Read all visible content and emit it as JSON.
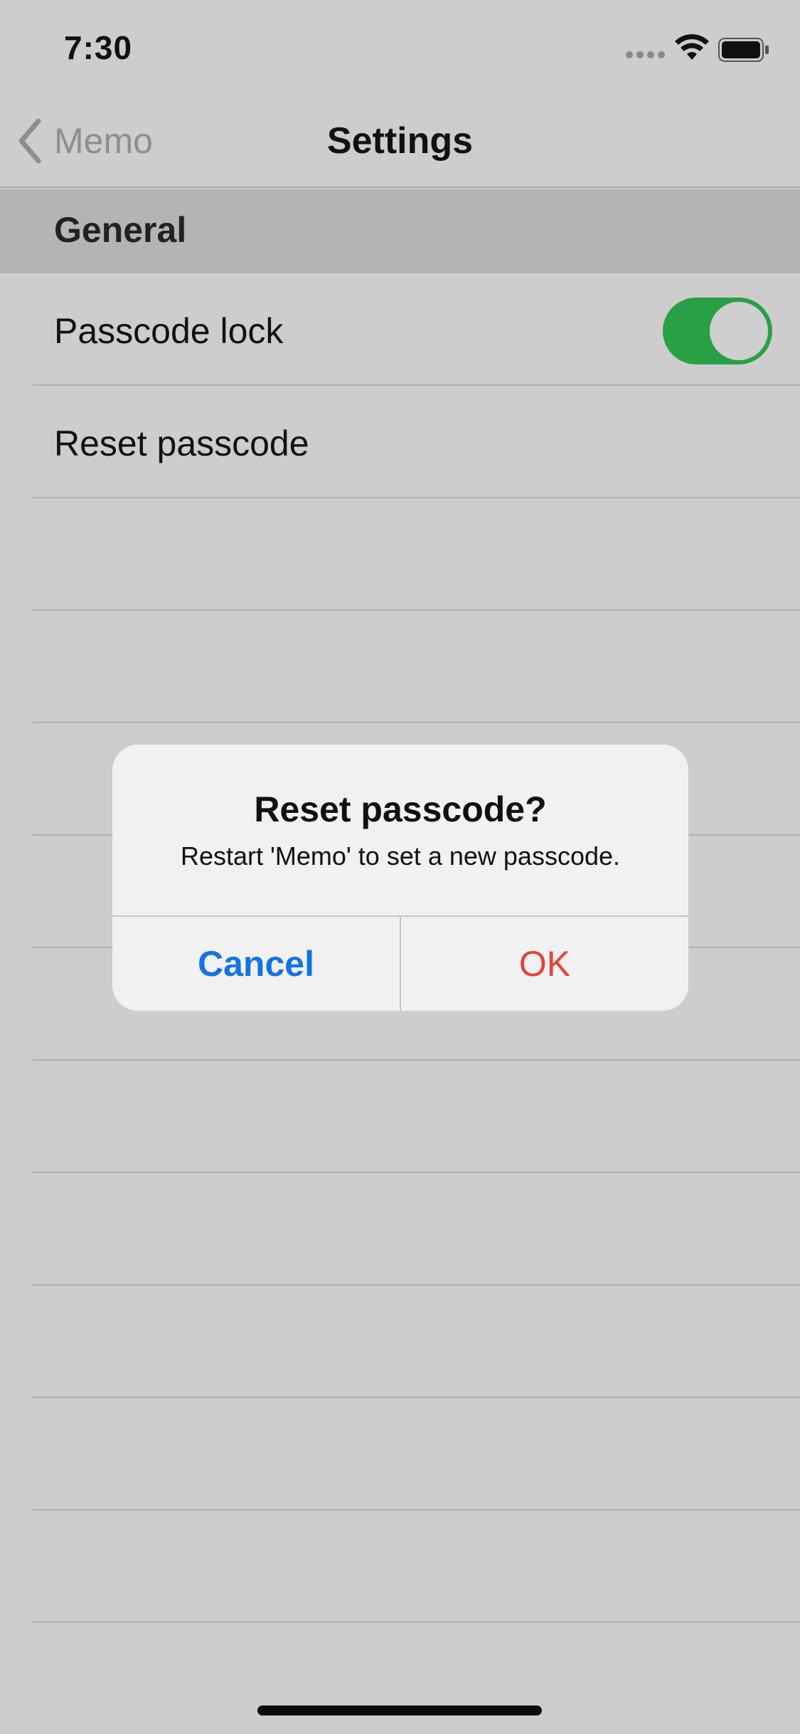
{
  "status_bar": {
    "time": "7:30",
    "icons": [
      "signal-icon",
      "wifi-icon",
      "battery-icon"
    ]
  },
  "nav": {
    "back_label": "Memo",
    "back_icon": "chevron-left-icon",
    "title": "Settings"
  },
  "section": {
    "header": "General"
  },
  "rows": [
    {
      "label": "Passcode lock",
      "has_toggle": true,
      "toggle_on": true
    },
    {
      "label": "Reset passcode"
    },
    {
      "label": ""
    },
    {
      "label": ""
    },
    {
      "label": ""
    },
    {
      "label": ""
    },
    {
      "label": ""
    },
    {
      "label": ""
    },
    {
      "label": ""
    },
    {
      "label": ""
    },
    {
      "label": ""
    },
    {
      "label": ""
    },
    {
      "label": ""
    }
  ],
  "alert": {
    "title": "Reset passcode?",
    "message": "Restart 'Memo' to set a new passcode.",
    "cancel_label": "Cancel",
    "ok_label": "OK"
  },
  "colors": {
    "background": "#cdcdcd",
    "section_header": "#b4b4b4",
    "toggle_on": "#28a046",
    "cancel": "#1273e3",
    "ok": "#e2433b",
    "back_text": "#8e8e8e"
  }
}
